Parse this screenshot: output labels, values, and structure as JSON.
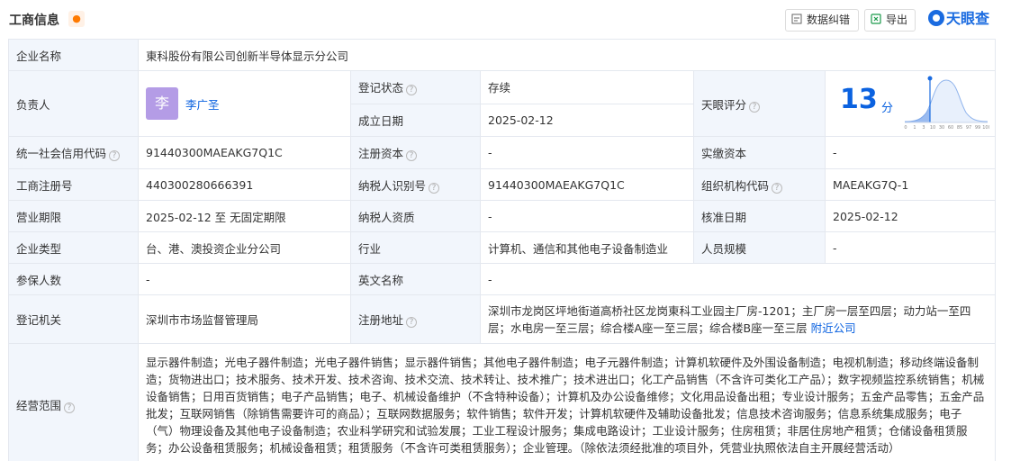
{
  "header": {
    "title": "工商信息",
    "feedback_label": "数据纠错",
    "export_label": "导出",
    "logo_text": "天眼查"
  },
  "company_name": {
    "label": "企业名称",
    "value": "東科股份有限公司创新半导体显示分公司"
  },
  "legal_person": {
    "label": "负责人",
    "avatar_char": "李",
    "name": "李广圣"
  },
  "reg_status": {
    "label": "登记状态",
    "value": "存续"
  },
  "established": {
    "label": "成立日期",
    "value": "2025-02-12"
  },
  "tianyan_score": {
    "label": "天眼评分",
    "value": "13",
    "unit": "分",
    "axis_ticks": [
      "0",
      "1",
      "3",
      "10",
      "30",
      "60",
      "85",
      "97",
      "99",
      "100"
    ]
  },
  "credit_code": {
    "label": "统一社会信用代码",
    "value": "91440300MAEAKG7Q1C"
  },
  "reg_capital": {
    "label": "注册资本",
    "value": "-"
  },
  "paid_capital": {
    "label": "实缴资本",
    "value": "-"
  },
  "reg_number": {
    "label": "工商注册号",
    "value": "440300280666391"
  },
  "taxpayer_id": {
    "label": "纳税人识别号",
    "value": "91440300MAEAKG7Q1C"
  },
  "org_code": {
    "label": "组织机构代码",
    "value": "MAEAKG7Q-1"
  },
  "business_term": {
    "label": "营业期限",
    "value": "2025-02-12 至 无固定期限"
  },
  "taxpayer_quality": {
    "label": "纳税人资质",
    "value": "-"
  },
  "approval_date": {
    "label": "核准日期",
    "value": "2025-02-12"
  },
  "company_type": {
    "label": "企业类型",
    "value": "台、港、澳投资企业分公司"
  },
  "industry": {
    "label": "行业",
    "value": "计算机、通信和其他电子设备制造业"
  },
  "staff_size": {
    "label": "人员规模",
    "value": "-"
  },
  "insured": {
    "label": "参保人数",
    "value": "-"
  },
  "english_name": {
    "label": "英文名称",
    "value": "-"
  },
  "reg_authority": {
    "label": "登记机关",
    "value": "深圳市市场监督管理局"
  },
  "reg_address": {
    "label": "注册地址",
    "value": "深圳市龙岗区坪地街道高桥社区龙岗東科工业园主厂房-1201；主厂房一层至四层；动力站一至四层；水电房一至三层；综合楼A座一至三层；综合楼B座一至三层",
    "nearby_label": "附近公司"
  },
  "business_scope": {
    "label": "经营范围",
    "value": "显示器件制造；光电子器件制造；光电子器件销售；显示器件销售；其他电子器件制造；电子元器件制造；计算机软硬件及外围设备制造；电视机制造；移动终端设备制造；货物进出口；技术服务、技术开发、技术咨询、技术交流、技术转让、技术推广；技术进出口；化工产品销售（不含许可类化工产品）；数字视频监控系统销售；机械设备销售；日用百货销售；电子产品销售；电子、机械设备维护（不含特种设备）；计算机及办公设备维修；文化用品设备出租；专业设计服务；五金产品零售；五金产品批发；互联网销售（除销售需要许可的商品）；互联网数据服务；软件销售；软件开发；计算机软硬件及辅助设备批发；信息技术咨询服务；信息系统集成服务；电子（气）物理设备及其他电子设备制造；农业科学研究和试验发展；工业工程设计服务；集成电路设计；工业设计服务；住房租赁；非居住房地产租赁；仓储设备租赁服务；办公设备租赁服务；机械设备租赁；租赁服务（不含许可类租赁服务）；企业管理。（除依法须经批准的项目外，凭营业执照依法自主开展经营活动）"
  }
}
